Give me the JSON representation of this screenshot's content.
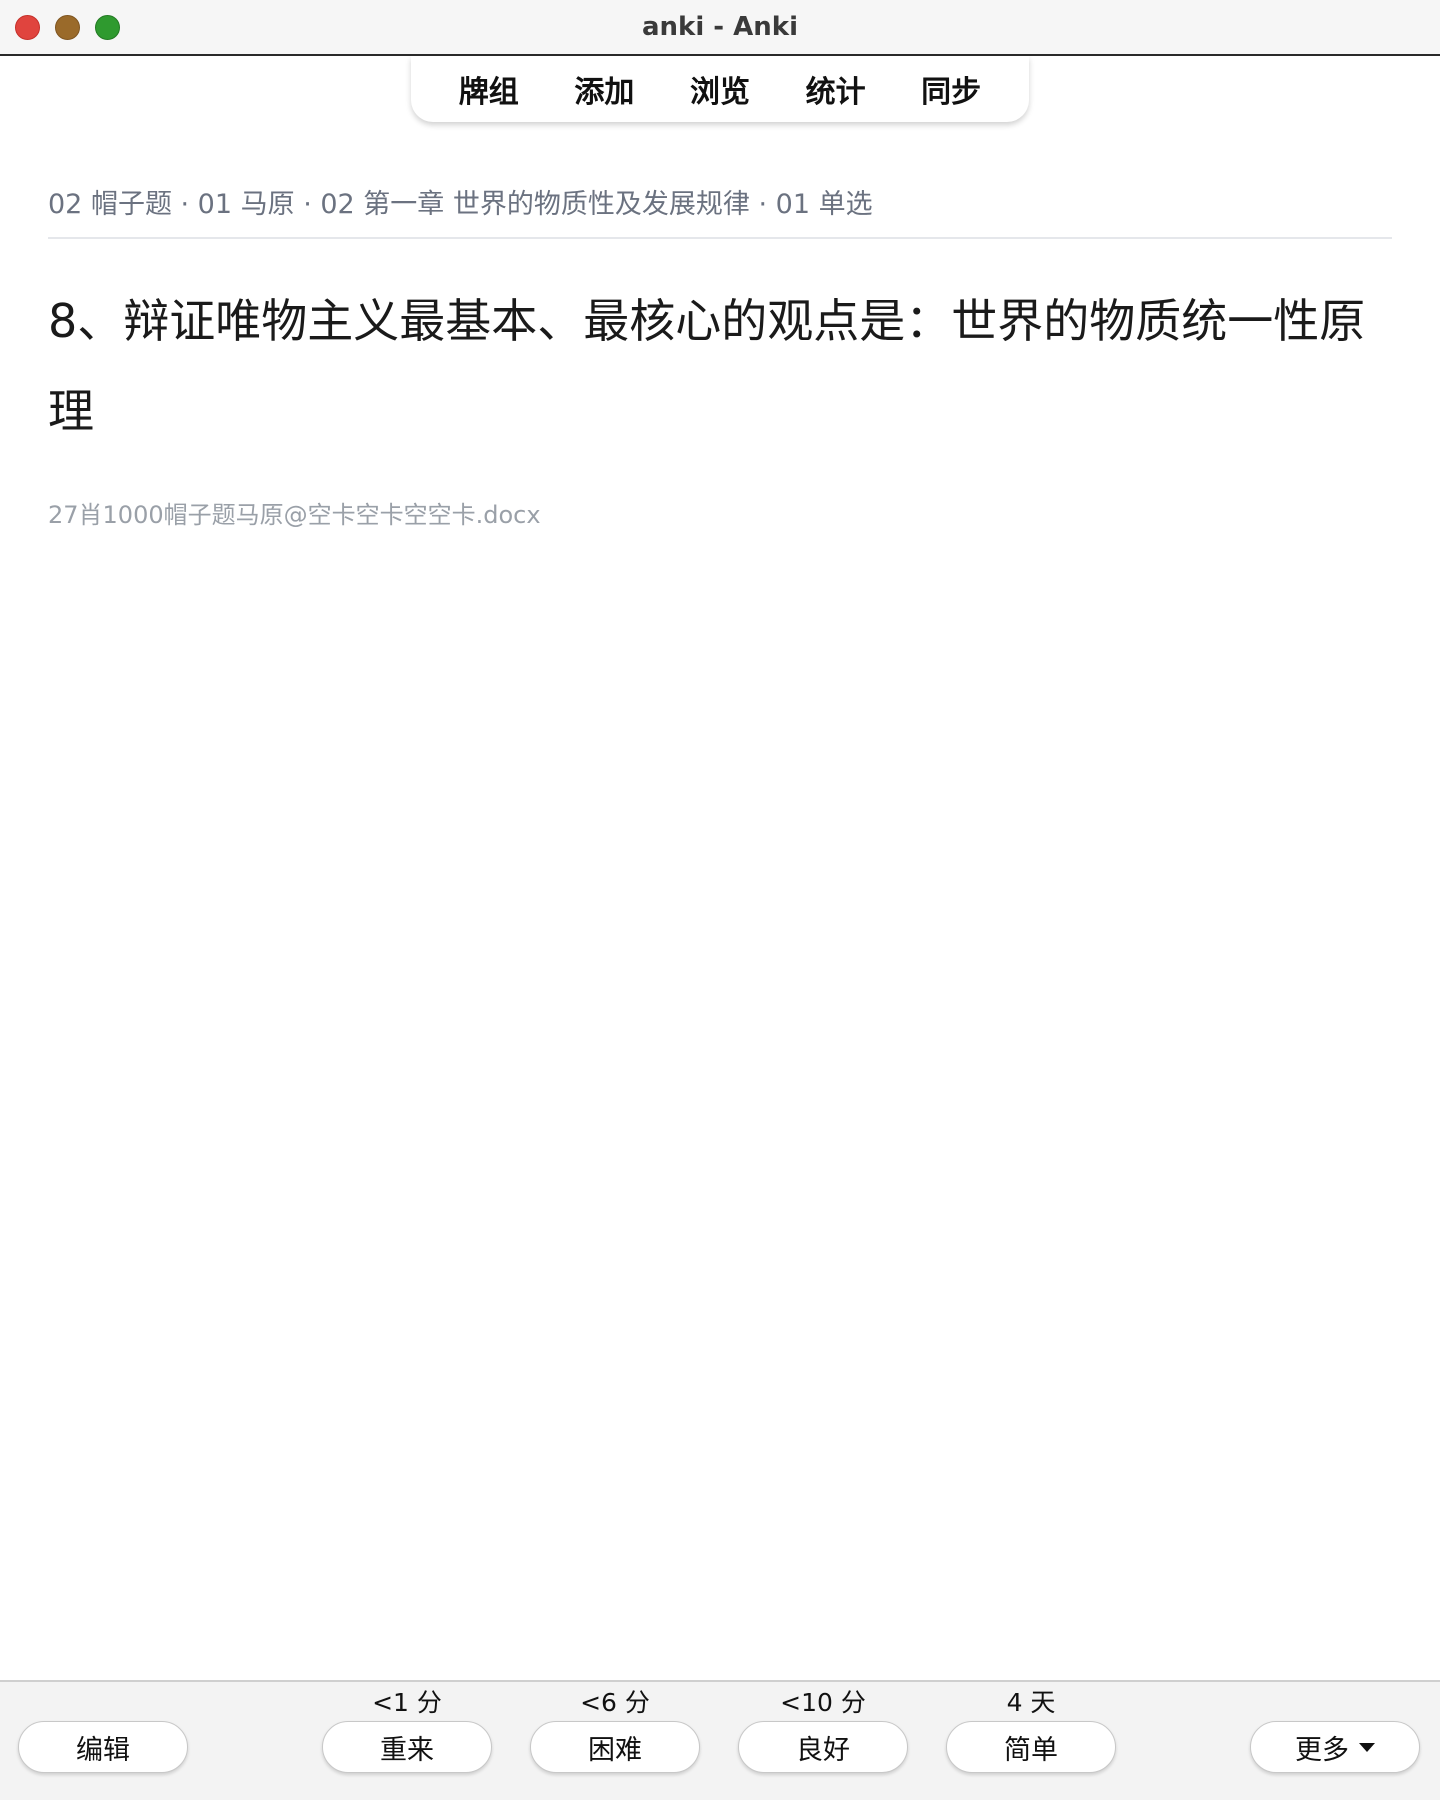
{
  "window": {
    "title": "anki - Anki"
  },
  "toolbar": {
    "items": [
      {
        "label": "牌组"
      },
      {
        "label": "添加"
      },
      {
        "label": "浏览"
      },
      {
        "label": "统计"
      },
      {
        "label": "同步"
      }
    ]
  },
  "card": {
    "breadcrumb": "02 帽子题 · 01 马原 · 02 第一章 世界的物质性及发展规律 · 01 单选",
    "question": "8、辩证唯物主义最基本、最核心的观点是：世界的物质统一性原理",
    "source": "27肖1000帽子题马原@空卡空卡空空卡.docx"
  },
  "bottom": {
    "edit_label": "编辑",
    "more_label": "更多",
    "answers": [
      {
        "interval": "<1 分",
        "label": "重来"
      },
      {
        "interval": "<6 分",
        "label": "困难"
      },
      {
        "interval": "<10 分",
        "label": "良好"
      },
      {
        "interval": "4 天",
        "label": "简单"
      }
    ]
  }
}
